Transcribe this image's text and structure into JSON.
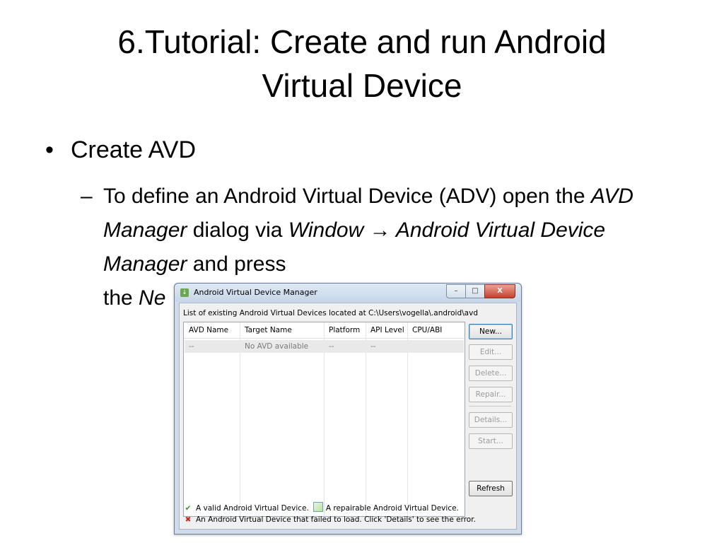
{
  "slide": {
    "title_line1": "6.Tutorial: Create and run Android",
    "title_line2": "Virtual Device",
    "bullet1": "Create AVD",
    "bullet2": {
      "dash": "–",
      "p1": "To define an Android Virtual Device (ADV) open the ",
      "em1": "AVD Manager",
      "p2": " dialog via ",
      "em2": "Window → Android Virtual Device Manager",
      "p3": " and press",
      "p4": "the ",
      "em3": "Ne"
    }
  },
  "dialog": {
    "title": "Android Virtual Device Manager",
    "window_buttons": {
      "minimize": "–",
      "maximize": "□",
      "close": "X"
    },
    "path_label": "List of existing Android Virtual Devices located at C:\\Users\\vogella\\.android\\avd",
    "table": {
      "columns": [
        "AVD Name",
        "Target Name",
        "Platform",
        "API Level",
        "CPU/ABI"
      ],
      "rows": [
        [
          "--",
          "No AVD available",
          "--",
          "--",
          ""
        ]
      ]
    },
    "buttons": {
      "new": "New...",
      "edit": "Edit...",
      "delete": "Delete...",
      "repair": "Repair...",
      "details": "Details...",
      "start": "Start...",
      "refresh": "Refresh"
    },
    "legend": {
      "valid": "A valid Android Virtual Device.",
      "repairable": "A repairable Android Virtual Device.",
      "failed": "An Android Virtual Device that failed to load. Click 'Details' to see the error."
    },
    "icons": {
      "check": "✔",
      "cross": "✖"
    }
  }
}
